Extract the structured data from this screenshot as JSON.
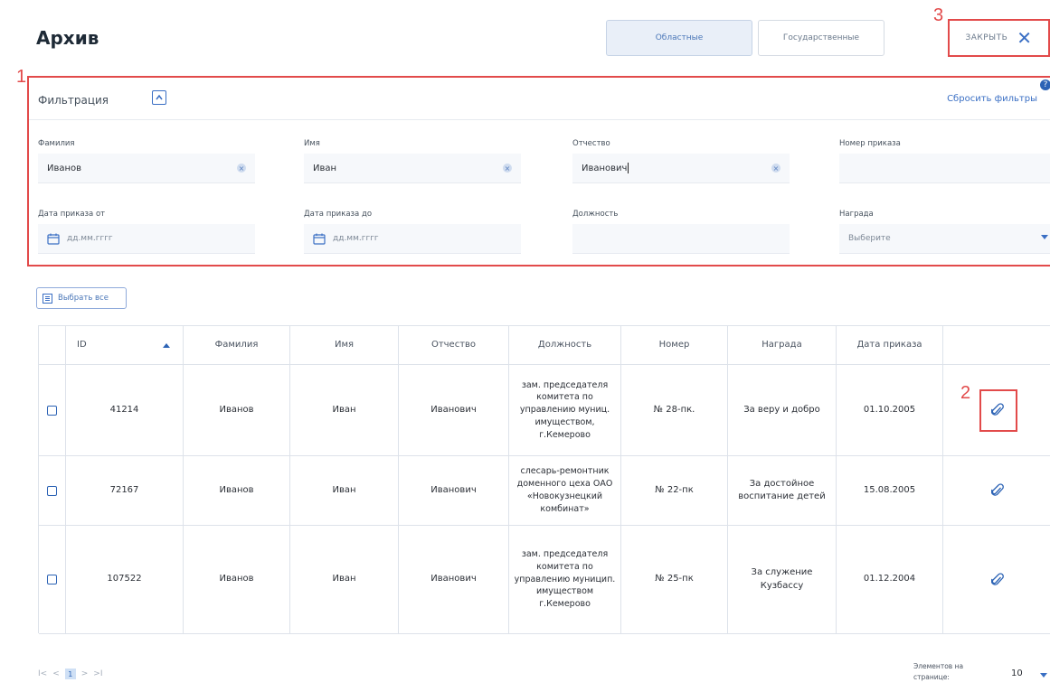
{
  "header": {
    "title": "Архив",
    "tab_regional": "Областные",
    "tab_state": "Государственные",
    "close_label": "ЗАКРЫТЬ"
  },
  "markers": {
    "m1": "1",
    "m2": "2",
    "m3": "3"
  },
  "filter": {
    "title": "Фильтрация",
    "reset_label": "Сбросить фильтры",
    "help": "?",
    "fields": {
      "surname_label": "Фамилия",
      "surname_value": "Иванов",
      "name_label": "Имя",
      "name_value": "Иван",
      "patronymic_label": "Отчество",
      "patronymic_value": "Иванович",
      "order_no_label": "Номер приказа",
      "order_no_value": "",
      "date_from_label": "Дата приказа от",
      "date_from_placeholder": "дд.мм.гггг",
      "date_to_label": "Дата приказа до",
      "date_to_placeholder": "дд.мм.гггг",
      "position_label": "Должность",
      "position_value": "",
      "award_label": "Награда",
      "award_placeholder": "Выберите"
    }
  },
  "table": {
    "select_all_label": "Выбрать все",
    "columns": [
      "ID",
      "Фамилия",
      "Имя",
      "Отчество",
      "Должность",
      "Номер",
      "Награда",
      "Дата приказа"
    ],
    "rows": [
      {
        "id": "41214",
        "surname": "Иванов",
        "name": "Иван",
        "patronymic": "Иванович",
        "position": "зам. председателя комитета по управлению муниц. имуществом, г.Кемерово",
        "number": "№ 28-пк.",
        "award": "За веру и добро",
        "date": "01.10.2005"
      },
      {
        "id": "72167",
        "surname": "Иванов",
        "name": "Иван",
        "patronymic": "Иванович",
        "position": "слесарь-ремонтник доменного цеха ОАО «Новокузнецкий комбинат»",
        "number": "№ 22-пк",
        "award": "За достойное воспитание детей",
        "date": "15.08.2005"
      },
      {
        "id": "107522",
        "surname": "Иванов",
        "name": "Иван",
        "patronymic": "Иванович",
        "position": "зам. председателя комитета по управлению муницип. имуществом г.Кемерово",
        "number": "№ 25-пк",
        "award": "За служение Кузбассу",
        "date": "01.12.2004"
      }
    ]
  },
  "pagination": {
    "first": "I<",
    "prev": "<",
    "current": "1",
    "next": ">",
    "last": ">I",
    "per_page_label": "Элементов на странице:",
    "per_page_value": "10"
  },
  "icons": {
    "close": "close-icon",
    "collapse": "chevron-up-icon",
    "calendar": "calendar-icon",
    "clip": "paperclip-icon",
    "clear": "clear-icon",
    "select_all": "select-all-icon",
    "sort": "sort-asc-icon"
  },
  "colors": {
    "accent": "#2c63b5",
    "highlight": "#e24a4a"
  }
}
